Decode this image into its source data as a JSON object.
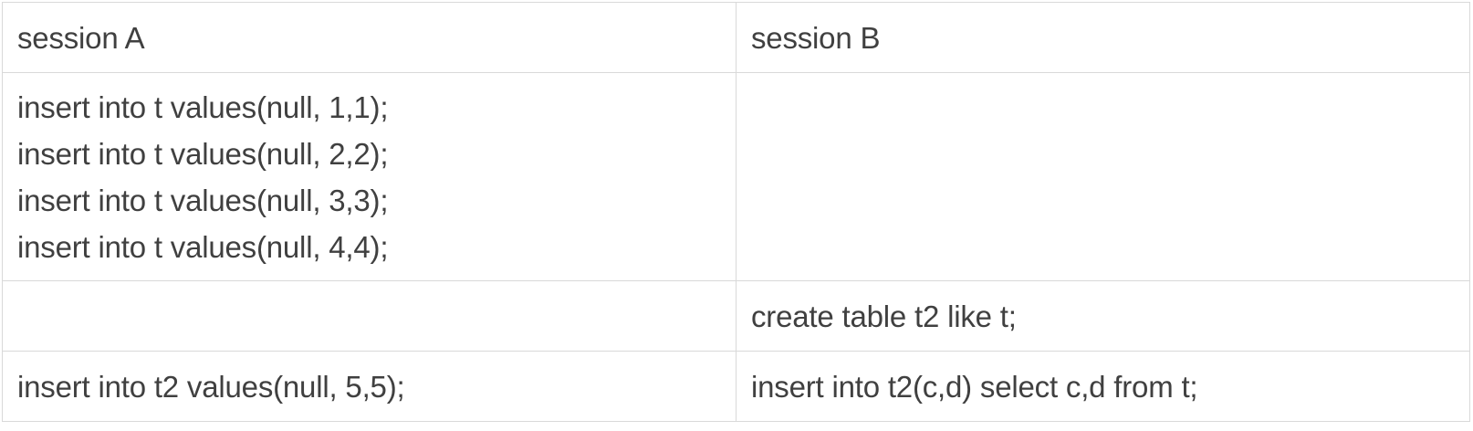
{
  "table": {
    "headers": [
      "session A",
      "session B"
    ],
    "rows": [
      {
        "session_a": [
          "insert into t values(null, 1,1);",
          "insert into t values(null, 2,2);",
          "insert into t values(null, 3,3);",
          "insert into t values(null, 4,4);"
        ],
        "session_b": []
      },
      {
        "session_a": [],
        "session_b": [
          "create table t2 like t;"
        ]
      },
      {
        "session_a": [
          "insert into t2 values(null, 5,5);"
        ],
        "session_b": [
          "insert into t2(c,d) select c,d from t;"
        ]
      }
    ]
  }
}
